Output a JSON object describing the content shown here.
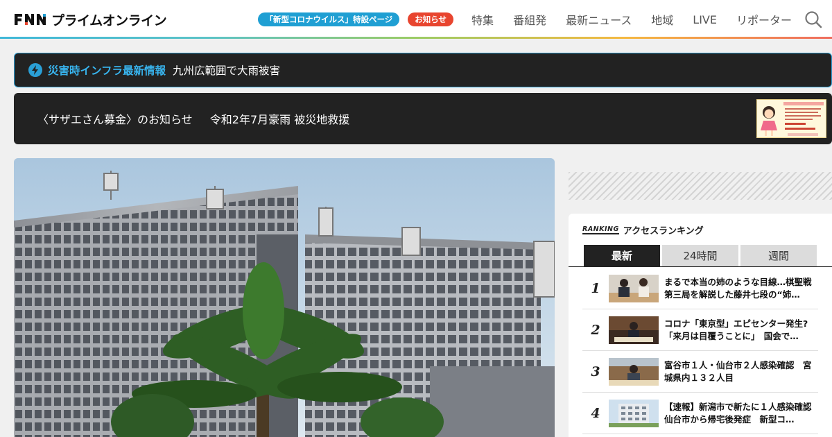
{
  "header": {
    "logo_text": "プライムオンライン",
    "logo_mark": "FNN",
    "special_pill": "「新型コロナウイルス」特設ページ",
    "notice_pill": "お知らせ",
    "nav": [
      "特集",
      "番組発",
      "最新ニュース",
      "地域",
      "LIVE",
      "リポーター"
    ],
    "search_icon": "search-icon",
    "accent_gradient": [
      "#40b8d8",
      "#9ccc65",
      "#f5b942",
      "#ef6d5f"
    ]
  },
  "alert": {
    "label": "災害時インフラ最新情報",
    "text": "九州広範囲で大雨被害",
    "icon": "lightning-icon",
    "accent": "#38b4ee"
  },
  "notice": {
    "title": "〈サザエさん募金〉のお知らせ",
    "subtitle": "令和2年7月豪雨 被災地救援"
  },
  "sidebar": {
    "ranking_badge": "RANKING",
    "ranking_title": "アクセスランキング",
    "tabs": [
      "最新",
      "24時間",
      "週間"
    ],
    "active_tab": "最新",
    "items": [
      {
        "rank": "1",
        "title": "まるで本当の姉のような目線…棋聖戦第三局を解説した藤井七段の“姉…"
      },
      {
        "rank": "2",
        "title": "コロナ「東京型」エピセンター発生?「来月は目覆うことに」　国会で…"
      },
      {
        "rank": "3",
        "title": "富谷市１人・仙台市２人感染確認　宮城県内１３２人目"
      },
      {
        "rank": "4",
        "title": "【速報】新潟市で新たに１人感染確認　仙台市から帰宅後発症　新型コ…"
      }
    ]
  }
}
